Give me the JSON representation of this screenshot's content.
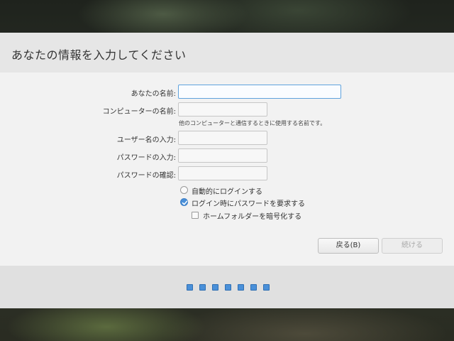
{
  "header": {
    "title": "あなたの情報を入力してください"
  },
  "form": {
    "name_label": "あなたの名前:",
    "name_value": "",
    "computer_label": "コンピューターの名前:",
    "computer_value": "",
    "computer_hint": "他のコンピューターと通信するときに使用する名前です。",
    "username_label": "ユーザー名の入力:",
    "username_value": "",
    "password_label": "パスワードの入力:",
    "password_value": "",
    "confirm_label": "パスワードの確認:",
    "confirm_value": ""
  },
  "options": {
    "auto_login": {
      "label": "自動的にログインする",
      "checked": false
    },
    "require_password": {
      "label": "ログイン時にパスワードを要求する",
      "checked": true
    },
    "encrypt_home": {
      "label": "ホームフォルダーを暗号化する",
      "checked": false
    }
  },
  "buttons": {
    "back": "戻る(B)",
    "continue": "続ける"
  },
  "progress": {
    "total_steps": 7
  },
  "colors": {
    "accent": "#4a90d9"
  }
}
